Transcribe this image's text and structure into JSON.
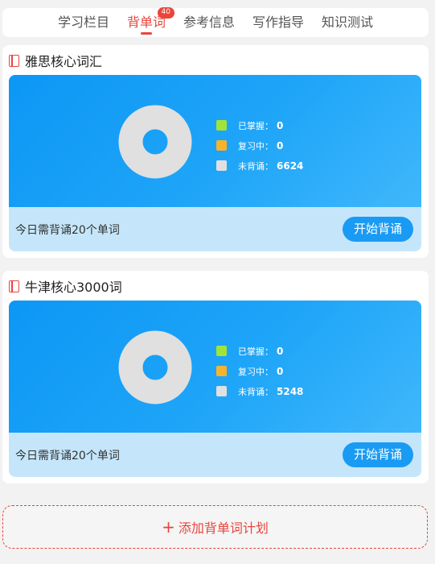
{
  "tabs": [
    {
      "label": "学习栏目"
    },
    {
      "label": "背单词",
      "badge": "40"
    },
    {
      "label": "参考信息"
    },
    {
      "label": "写作指导"
    },
    {
      "label": "知识测试"
    }
  ],
  "colors": {
    "accent": "#e8453c",
    "mastered": "#a2e33a",
    "reviewing": "#f7b32b",
    "unlearned": "#e0e0e0",
    "button": "#1a9bf3"
  },
  "plans": [
    {
      "title": "雅思核心词汇",
      "legend": [
        {
          "label": "已掌握：",
          "value": "0"
        },
        {
          "label": "复习中：",
          "value": "0"
        },
        {
          "label": "未背诵：",
          "value": "6624"
        }
      ],
      "today_text": "今日需背诵20个单词",
      "start_label": "开始背诵"
    },
    {
      "title": "牛津核心3000词",
      "legend": [
        {
          "label": "已掌握：",
          "value": "0"
        },
        {
          "label": "复习中：",
          "value": "0"
        },
        {
          "label": "未背诵：",
          "value": "5248"
        }
      ],
      "today_text": "今日需背诵20个单词",
      "start_label": "开始背诵"
    }
  ],
  "add_plan": {
    "icon": "plus-icon",
    "label": "添加背单词计划"
  }
}
